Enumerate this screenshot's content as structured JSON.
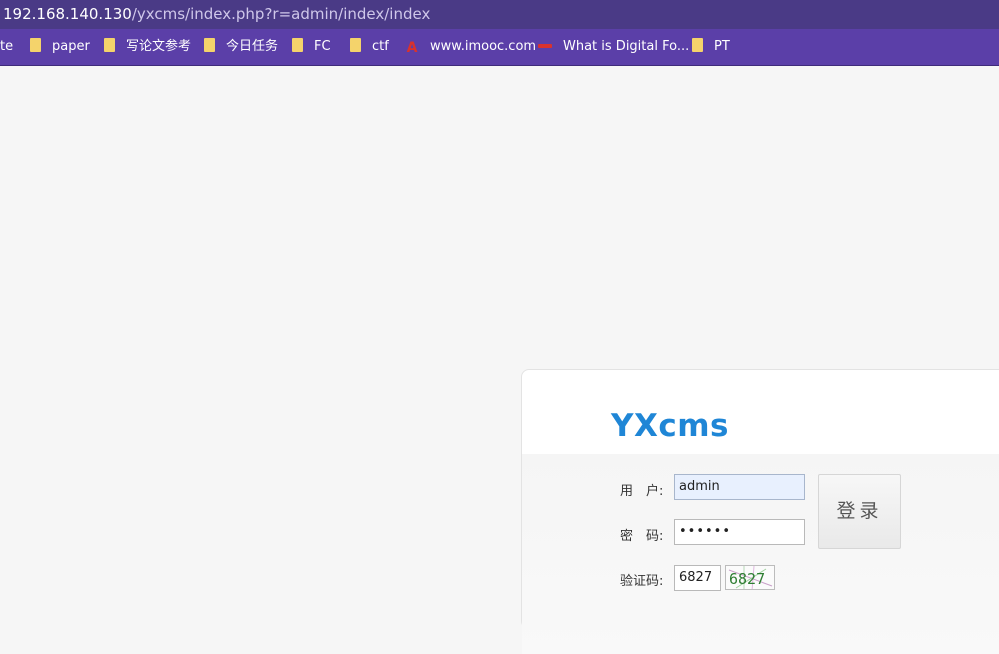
{
  "url": {
    "host": "192.168.140.130",
    "path": "/yxcms/index.php?r=admin/index/index"
  },
  "bookmarks": [
    {
      "label": "te",
      "icon": "none"
    },
    {
      "label": "paper",
      "icon": "folder-icon"
    },
    {
      "label": "写论文参考",
      "icon": "folder-icon"
    },
    {
      "label": "今日任务",
      "icon": "folder-icon"
    },
    {
      "label": "FC",
      "icon": "folder-icon"
    },
    {
      "label": "ctf",
      "icon": "folder-icon"
    },
    {
      "label": "www.imooc.com",
      "icon": "imooc-icon"
    },
    {
      "label": "What is Digital Fo...",
      "icon": "site-icon"
    },
    {
      "label": "PT",
      "icon": "folder-icon"
    }
  ],
  "login": {
    "logo": "YXcms",
    "username_label": "用　户:",
    "username_value": "admin",
    "password_label": "密　码:",
    "password_value": "••••••",
    "captcha_label": "验证码:",
    "captcha_value": "6827",
    "captcha_image_text": "6827",
    "login_button": "登录"
  },
  "colors": {
    "url_bar": "#4a3a86",
    "bookmarks_bar": "#5b3fa8",
    "logo": "#1f86d6",
    "autofill": "#e8f0fe"
  }
}
